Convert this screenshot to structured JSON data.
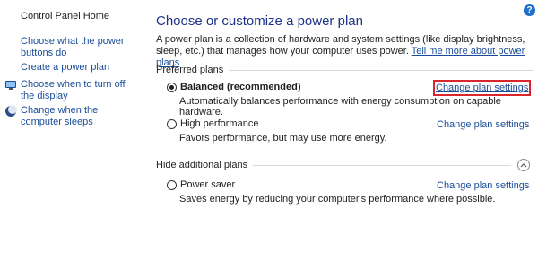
{
  "sidebar": {
    "home": "Control Panel Home",
    "links": [
      {
        "label": "Choose what the power buttons do"
      },
      {
        "label": "Create a power plan"
      },
      {
        "label": "Choose when to turn off the display",
        "icon": "display-icon"
      },
      {
        "label": "Change when the computer sleeps",
        "icon": "moon-icon"
      }
    ]
  },
  "main": {
    "title": "Choose or customize a power plan",
    "description": "A power plan is a collection of hardware and system settings (like display brightness, sleep, etc.) that manages how your computer uses power.",
    "learn_more": "Tell me more about power plans",
    "preferred_header": "Preferred plans",
    "hidden_header": "Hide additional plans",
    "change_label": "Change plan settings",
    "plans": [
      {
        "name": "Balanced (recommended)",
        "description": "Automatically balances performance with energy consumption on capable hardware.",
        "selected": true
      },
      {
        "name": "High performance",
        "description": "Favors performance, but may use more energy.",
        "selected": false
      },
      {
        "name": "Power saver",
        "description": "Saves energy by reducing your computer's performance where possible.",
        "selected": false
      }
    ]
  },
  "help_label": "?"
}
